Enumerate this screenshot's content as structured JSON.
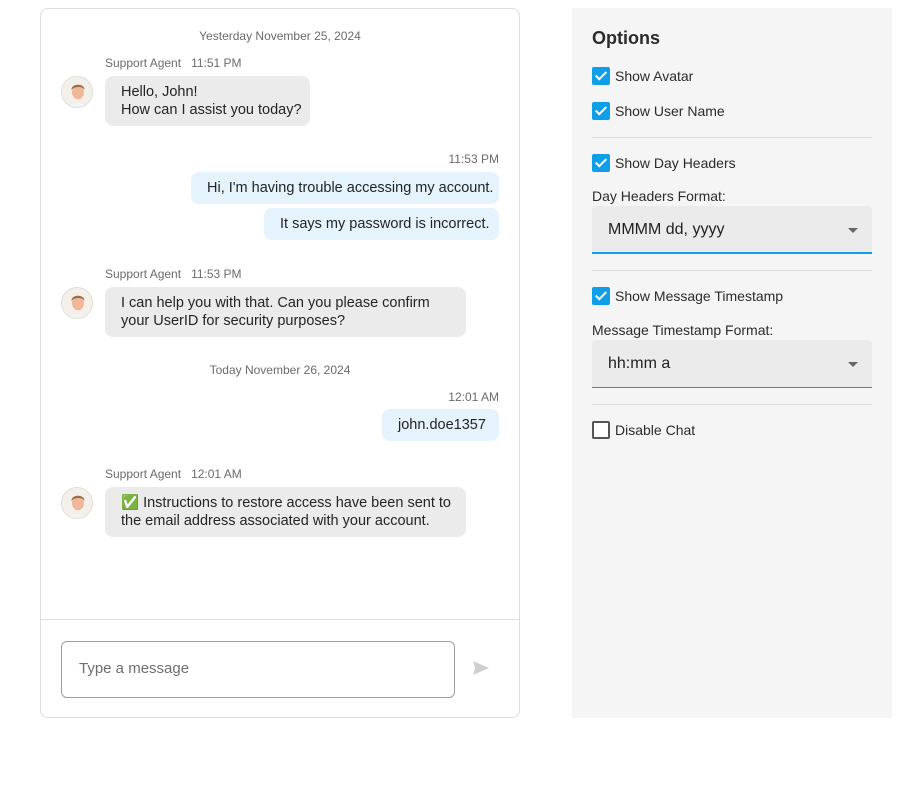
{
  "chat": {
    "day_headers": [
      "Yesterday November 25, 2024",
      "Today November 26, 2024"
    ],
    "messages": [
      {
        "author": "Support Agent",
        "time": "11:51 PM",
        "lines": [
          "Hello, John!",
          "How can I assist you today?"
        ]
      },
      {
        "time": "11:53 PM",
        "text1": "Hi, I'm having trouble accessing my account.",
        "text2": "It says my password is incorrect."
      },
      {
        "author": "Support Agent",
        "time": "11:53 PM",
        "lines": [
          "I can help you with that. Can you please confirm",
          "your UserID for security purposes?"
        ]
      },
      {
        "time": "12:01 AM",
        "text": "john.doe1357"
      },
      {
        "author": "Support Agent",
        "time": "12:01 AM",
        "lines": [
          "✅ Instructions to restore access have been sent to",
          "the email address associated with your account."
        ]
      }
    ],
    "composer": {
      "placeholder": "Type a message",
      "send_icon": "send-icon"
    }
  },
  "options": {
    "title": "Options",
    "show_avatar": {
      "label": "Show Avatar",
      "checked": true
    },
    "show_user_name": {
      "label": "Show User Name",
      "checked": true
    },
    "show_day_headers": {
      "label": "Show Day Headers",
      "checked": true
    },
    "day_headers_format": {
      "label": "Day Headers Format:",
      "value": "MMMM dd, yyyy"
    },
    "show_message_timestamp": {
      "label": "Show Message Timestamp",
      "checked": true
    },
    "message_timestamp_format": {
      "label": "Message Timestamp Format:",
      "value": "hh:mm a"
    },
    "disable_chat": {
      "label": "Disable Chat",
      "checked": false
    }
  },
  "colors": {
    "accent": "#0f9ee8",
    "incoming_bubble": "#ebebeb",
    "outgoing_bubble": "#e5f3fc"
  }
}
